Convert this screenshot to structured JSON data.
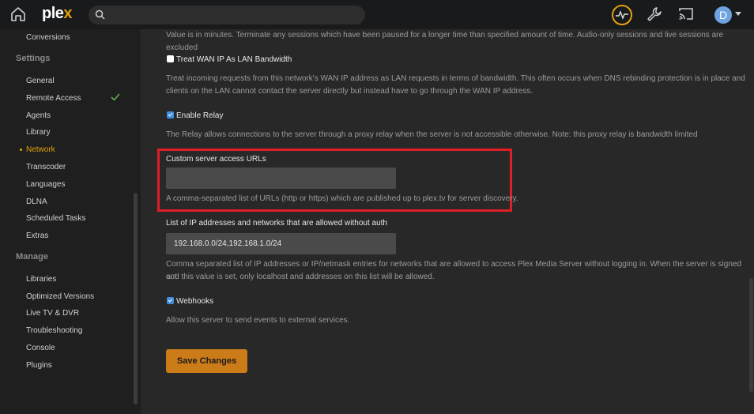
{
  "header": {
    "logo_text": "plex",
    "search_placeholder": "",
    "avatar_initial": "D",
    "accent_color": "#e5a00d"
  },
  "sidebar": {
    "top_item": "Conversions",
    "settings_heading": "Settings",
    "settings_items": [
      {
        "label": "General"
      },
      {
        "label": "Remote Access",
        "status": "check-icon"
      },
      {
        "label": "Agents"
      },
      {
        "label": "Library"
      },
      {
        "label": "Network",
        "active": true
      },
      {
        "label": "Transcoder"
      },
      {
        "label": "Languages"
      },
      {
        "label": "DLNA"
      },
      {
        "label": "Scheduled Tasks"
      },
      {
        "label": "Extras"
      }
    ],
    "manage_heading": "Manage",
    "manage_items": [
      {
        "label": "Libraries"
      },
      {
        "label": "Optimized Versions"
      },
      {
        "label": "Live TV & DVR"
      },
      {
        "label": "Troubleshooting"
      },
      {
        "label": "Console"
      },
      {
        "label": "Plugins"
      }
    ]
  },
  "main": {
    "cut_off_text": "Value is in minutes. Terminate any sessions which have been paused for a longer time than specified amount of time. Audio-only sessions and live sessions are excluded",
    "wan_ip": {
      "label": "Treat WAN IP As LAN Bandwidth",
      "checked": false,
      "help_line1": "Treat incoming requests from this network's WAN IP address as LAN requests in terms of bandwidth. This often occurs when DNS rebinding protection is in place and",
      "help_line2": "clients on the LAN cannot contact the server directly but instead have to go through the WAN IP address."
    },
    "relay": {
      "label": "Enable Relay",
      "checked": true,
      "help": "The Relay allows connections to the server through a proxy relay when the server is not accessible otherwise. Note: this proxy relay is bandwidth limited"
    },
    "custom_urls": {
      "label": "Custom server access URLs",
      "value": "",
      "help": "A comma-separated list of URLs (http or https) which are published up to plex.tv for server discovery."
    },
    "allowed_networks": {
      "label": "List of IP addresses and networks that are allowed without auth",
      "value": "192.168.0.0/24,192.168.1.0/24",
      "help_line1": "Comma separated list of IP addresses or IP/netmask entries for networks that are allowed to access Plex Media Server without logging in. When the server is signed out",
      "help_line2": "and this value is set, only localhost and addresses on this list will be allowed."
    },
    "webhooks": {
      "label": "Webhooks",
      "checked": true,
      "help": "Allow this server to send events to external services."
    },
    "save_label": "Save Changes"
  }
}
